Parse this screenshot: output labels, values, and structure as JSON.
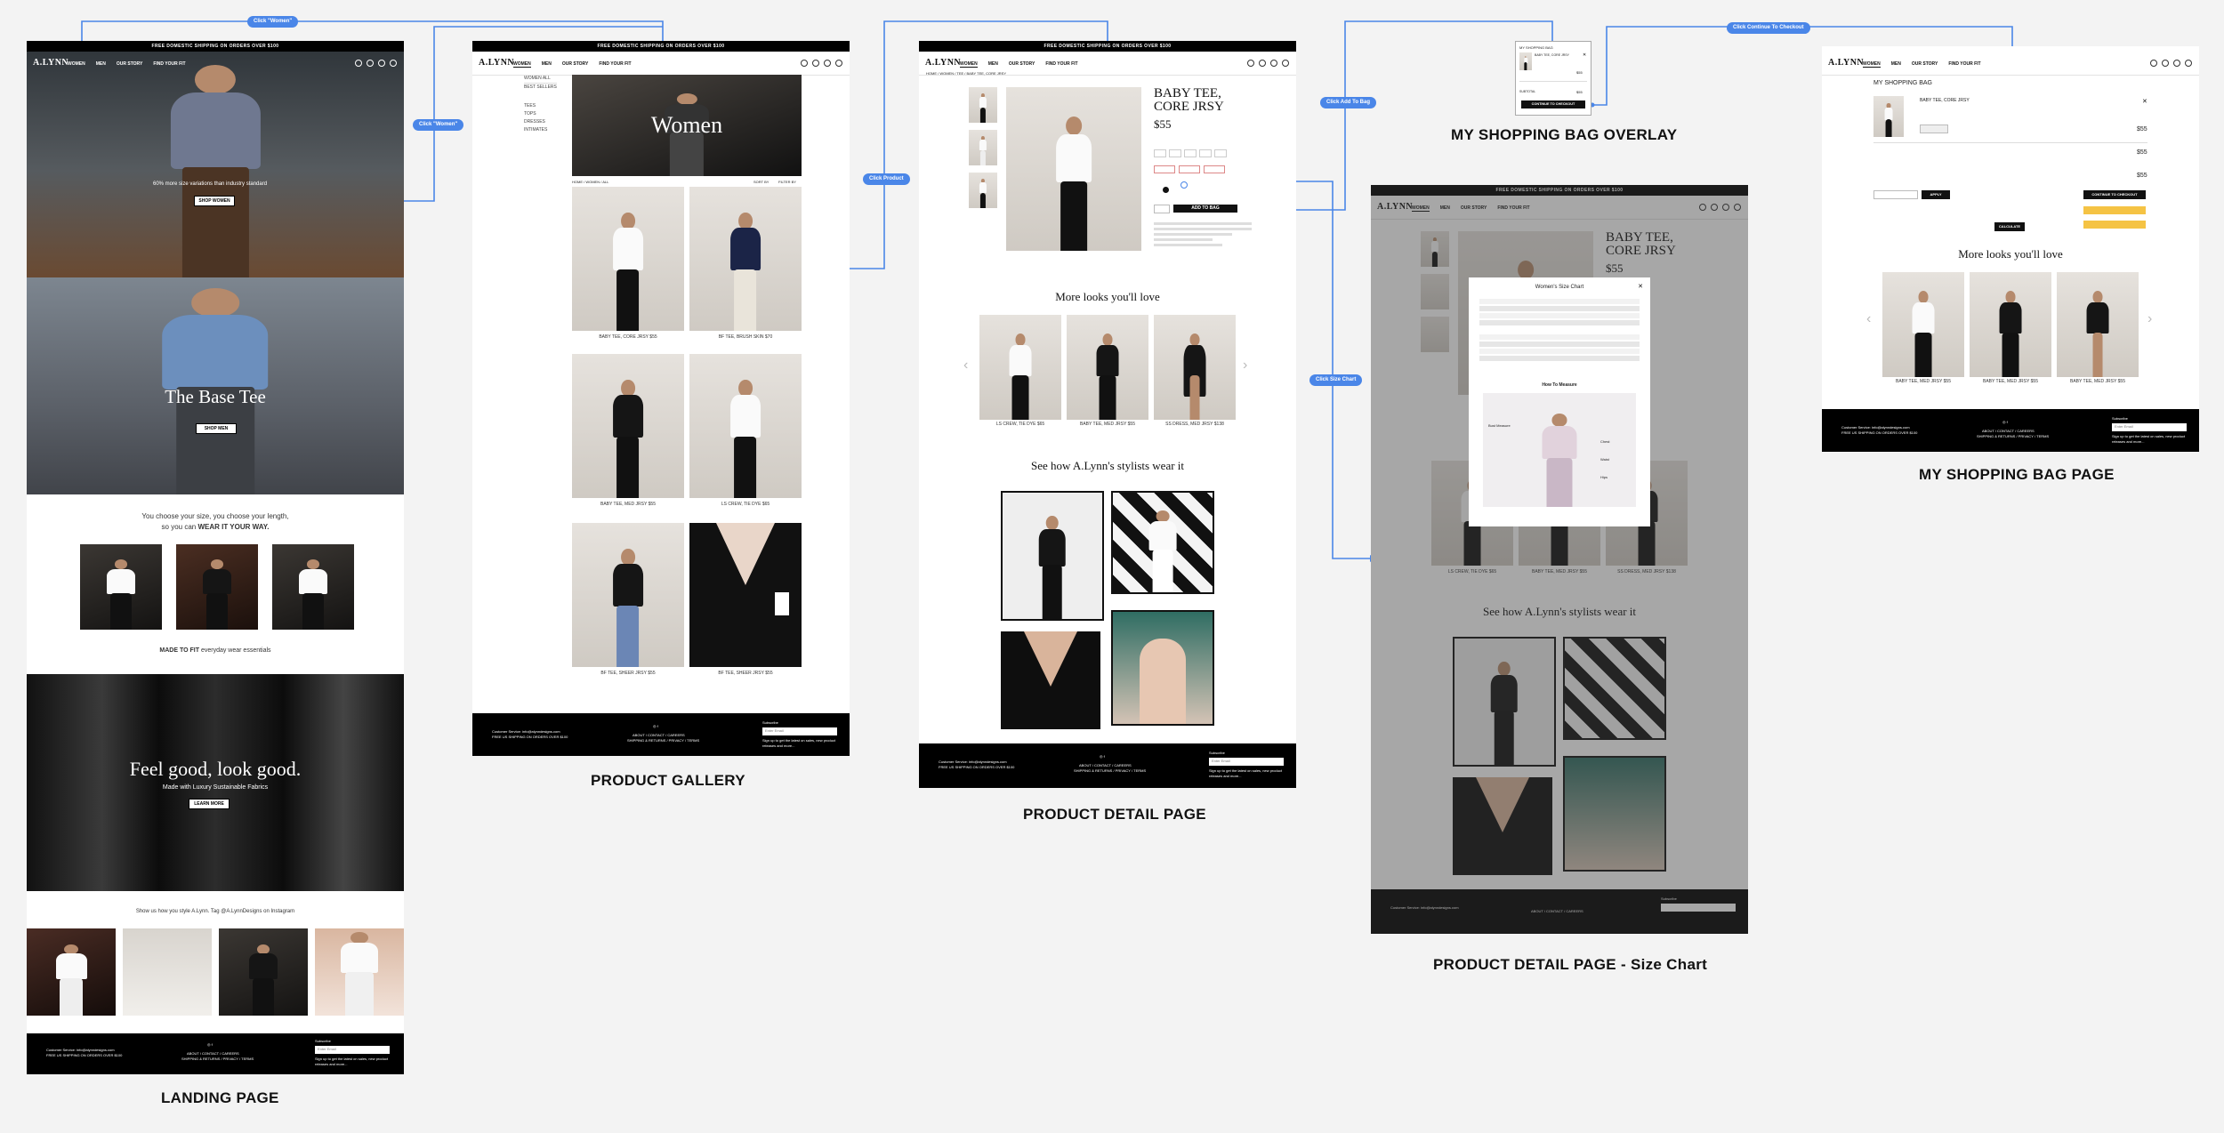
{
  "site": {
    "logo": "A.LYNN",
    "topbar_text": "FREE DOMESTIC SHIPPING ON ORDERS OVER $100",
    "nav": [
      "WOMEN",
      "MEN",
      "OUR STORY",
      "FIND YOUR FIT"
    ]
  },
  "frame_titles": {
    "landing": "LANDING PAGE",
    "gallery": "PRODUCT GALLERY",
    "detail": "PRODUCT DETAIL PAGE",
    "overlay": "MY SHOPPING BAG OVERLAY",
    "sizechart": "PRODUCT DETAIL PAGE - Size Chart",
    "bag": "MY SHOPPING BAG PAGE"
  },
  "flow_labels": {
    "women_top": "Click \"Women\"",
    "women_side": "Click \"Women\"",
    "product": "Click Product",
    "add_to_bag": "Click Add To Bag",
    "size_chart": "Click Size Chart",
    "checkout": "Click Continue To Checkout"
  },
  "landing": {
    "hero_text": "60% more size variations than industry standard",
    "hero_button": "SHOP WOMEN",
    "base_tee_title": "The Base Tee",
    "base_tee_button": "SHOP MEN",
    "choose_line1": "You choose your size, you choose your length,",
    "choose_line2_pre": "so you can ",
    "choose_line2_bold": "WEAR IT YOUR WAY.",
    "made_to_fit_bold": "MADE TO FIT",
    "made_to_fit_rest": " everyday wear essentials",
    "feel_good_title": "Feel good, look good.",
    "feel_good_sub": "Made with Luxury Sustainable Fabrics",
    "learn_more": "LEARN MORE",
    "instagram_line": "Show us how you style A.Lynn. Tag @A.LynnDesigns on Instagram"
  },
  "footer": {
    "service": "Customer Service: info@alynndesigns.com",
    "shipping": "FREE US SHIPPING ON ORDERS OVER $100",
    "links1": "ABOUT  /  CONTACT  /  CAREERS",
    "links2": "SHIPPING & RETURNS  /  PRIVACY  /  TERMS",
    "subscribe": "Subscribe",
    "email_placeholder": "Enter Email",
    "signup": "Sign up to get the latest on sales, new product releases and more..."
  },
  "gallery": {
    "hero_title": "Women",
    "sidebar": [
      "WOMEN ALL",
      "BEST SELLERS",
      "TEES",
      "TOPS",
      "DRESSES",
      "INTIMATES"
    ],
    "breadcrumb": "HOME / WOMEN / ALL",
    "sort": "SORT BY",
    "filter": "FILTER BY",
    "products": [
      "BABY TEE, CORE JRSY  $55",
      "BF TEE, BRUSH SKIN  $70",
      "BABY TEE, MED JRSY  $55",
      "LS CREW, TIE DYE  $65",
      "BF TEE, SHEER JRSY  $55",
      "BF TEE, SHEER JRSY  $55"
    ]
  },
  "detail": {
    "breadcrumb": "HOME  /  WOMEN  /  TEE  /  BABY TEE, CORE JRSY",
    "title_line1": "BABY TEE,",
    "title_line2": "CORE JRSY",
    "price": "$55",
    "add_to_bag": "ADD TO BAG",
    "more_looks": "More looks you'll love",
    "stylists": "See how A.Lynn's stylists wear it",
    "recs": [
      "LS CREW, TIE DYE  $65",
      "BABY TEE, MED JRSY  $55",
      "SS DRESS, MED JRSY  $138"
    ]
  },
  "overlay": {
    "title": "MY SHOPPING BAG",
    "item": "BABY TEE, CORE JRSY",
    "price": "$55",
    "subtotal": "SUBTOTAL",
    "button": "CONTINUE TO CHECKOUT"
  },
  "sizechart": {
    "title": "Women's Size Chart",
    "how_to": "How To Measure",
    "labels": [
      "Bust Measure",
      "Chest",
      "Waist",
      "Hips"
    ]
  },
  "bag": {
    "title": "MY SHOPPING BAG",
    "item": "BABY TEE, CORE JRSY",
    "price": "$55",
    "checkout": "CONTINUE TO CHECKOUT",
    "apply": "APPLY",
    "calculate": "CALCULATE",
    "more_looks": "More looks you'll love",
    "recs": [
      "BABY TEE, MED JRSY  $55",
      "BABY TEE, MED JRSY  $55",
      "BABY TEE, MED JRSY  $55"
    ]
  },
  "colors": {
    "flow_blue": "#4a86e8",
    "paypal_yellow": "#f5c344"
  }
}
